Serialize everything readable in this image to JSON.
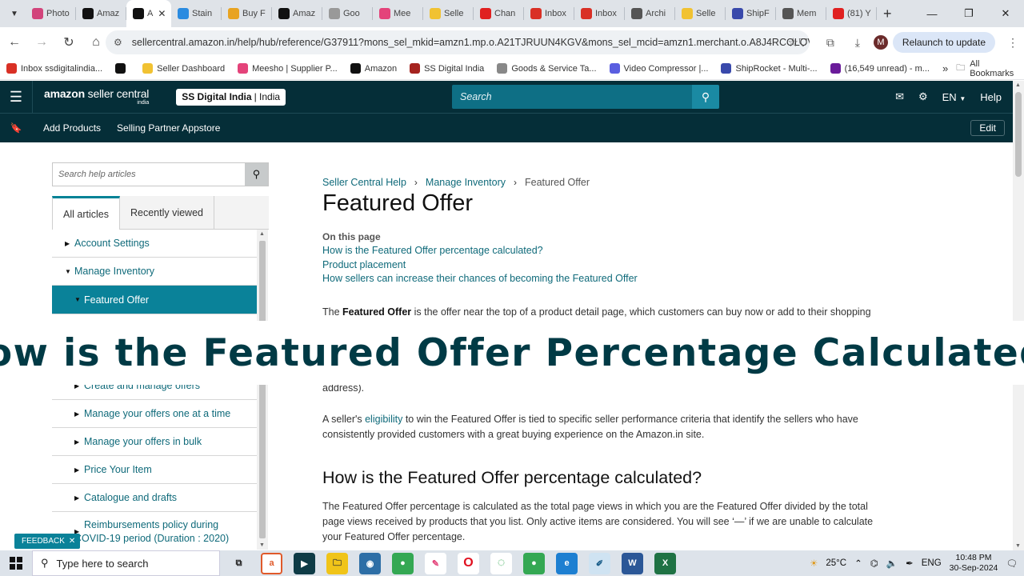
{
  "browser": {
    "tabs": [
      {
        "label": "Photo",
        "color": "#d2447b"
      },
      {
        "label": "Amaz",
        "color": "#111111"
      },
      {
        "label": "A",
        "color": "#111111",
        "active": true
      },
      {
        "label": "Stain",
        "color": "#2b8be0"
      },
      {
        "label": "Buy F",
        "color": "#e8a321"
      },
      {
        "label": "Amaz",
        "color": "#111111"
      },
      {
        "label": "Goo",
        "color": "#999999"
      },
      {
        "label": "Mee",
        "color": "#e4437a"
      },
      {
        "label": "Selle",
        "color": "#f1c232"
      },
      {
        "label": "Chan",
        "color": "#e02020"
      },
      {
        "label": "Inbox",
        "color": "#d93025"
      },
      {
        "label": "Inbox",
        "color": "#d93025"
      },
      {
        "label": "Archi",
        "color": "#555555"
      },
      {
        "label": "Selle",
        "color": "#f1c232"
      },
      {
        "label": "ShipF",
        "color": "#3949ab"
      },
      {
        "label": "Mem",
        "color": "#555555"
      },
      {
        "label": "(81) Y",
        "color": "#e02020"
      }
    ],
    "url": "sellercentral.amazon.in/help/hub/reference/G37911?mons_sel_mkid=amzn1.mp.o.A21TJRUUN4KGV&mons_sel_mcid=amzn1.merchant.o.A8J4RCOLOV08K&...",
    "relaunch_label": "Relaunch to update",
    "avatar_letter": "M",
    "bookmarks": [
      {
        "label": "Inbox ssdigitalindia...",
        "color": "#d93025"
      },
      {
        "label": "",
        "color": "#111111"
      },
      {
        "label": "Seller Dashboard",
        "color": "#f1c232"
      },
      {
        "label": "Meesho | Supplier P...",
        "color": "#e4437a"
      },
      {
        "label": "Amazon",
        "color": "#111111"
      },
      {
        "label": "SS Digital India",
        "color": "#a5231f"
      },
      {
        "label": "Goods & Service Ta...",
        "color": "#888888"
      },
      {
        "label": "Video Compressor |...",
        "color": "#5a5ee0"
      },
      {
        "label": "ShipRocket - Multi-...",
        "color": "#3949ab"
      },
      {
        "label": "(16,549 unread) - m...",
        "color": "#6a1b9a"
      }
    ],
    "all_bookmarks": "All Bookmarks"
  },
  "header": {
    "logo_main": "amazon",
    "logo_rest": "seller central",
    "logo_sub": "india",
    "store_name": "SS Digital India",
    "store_region": "| India",
    "search_placeholder": "Search",
    "lang": "EN",
    "help": "Help",
    "subnav": [
      "Add Products",
      "Selling Partner Appstore"
    ],
    "edit": "Edit"
  },
  "sidebar": {
    "search_placeholder": "Search help articles",
    "tabs": [
      "All articles",
      "Recently viewed"
    ],
    "items": [
      {
        "label": "Account Settings",
        "arrow": "▶",
        "indent": 0
      },
      {
        "label": "Manage Inventory",
        "arrow": "▼",
        "indent": 0
      },
      {
        "label": "Featured Offer",
        "arrow": "▼",
        "indent": 1,
        "selected": true
      },
      {
        "label": "Create and manage offers",
        "arrow": "▶",
        "indent": 1
      },
      {
        "label": "Manage your offers one at a time",
        "arrow": "▶",
        "indent": 1
      },
      {
        "label": "Manage your offers in bulk",
        "arrow": "▶",
        "indent": 1
      },
      {
        "label": "Price Your Item",
        "arrow": "▶",
        "indent": 1
      },
      {
        "label": "Catalogue and drafts",
        "arrow": "▶",
        "indent": 1
      },
      {
        "label": "Reimbursements policy during",
        "label2": "COVID-19 period (Duration : 2020)",
        "arrow": "▶",
        "indent": 1
      }
    ],
    "feedback": "FEEDBACK"
  },
  "article": {
    "breadcrumb": [
      "Seller Central Help",
      "Manage Inventory",
      "Featured Offer"
    ],
    "title": "Featured Offer",
    "on_this_page": "On this page",
    "toc": [
      "How is the Featured Offer percentage calculated?",
      "Product placement",
      "How sellers can increase their chances of becoming the Featured Offer"
    ],
    "p1_pre": "The ",
    "p1_bold": "Featured Offer",
    "p1_post": " is the offer near the top of a product detail page, which customers can buy now or add to their shopping",
    "p1_tail": "address).",
    "p2_pre": "A seller's ",
    "p2_link": "eligibility",
    "p2_post": " to win the Featured Offer is tied to specific seller performance criteria that identify the sellers who have consistently provided customers with a great buying experience on the Amazon.in site.",
    "h2": "How is the Featured Offer percentage calculated?",
    "p3": "The Featured Offer percentage is calculated as the total page views in which you are the Featured Offer divided by the total page views received by products that you list. Only active items are considered. You will see ‘—’ if we are unable to calculate your Featured Offer percentage."
  },
  "banner": "How is the Featured Offer Percentage Calculated?",
  "taskbar": {
    "search_placeholder": "Type here to search",
    "weather": "25°C",
    "lang": "ENG",
    "time": "10:48 PM",
    "date": "30-Sep-2024"
  }
}
